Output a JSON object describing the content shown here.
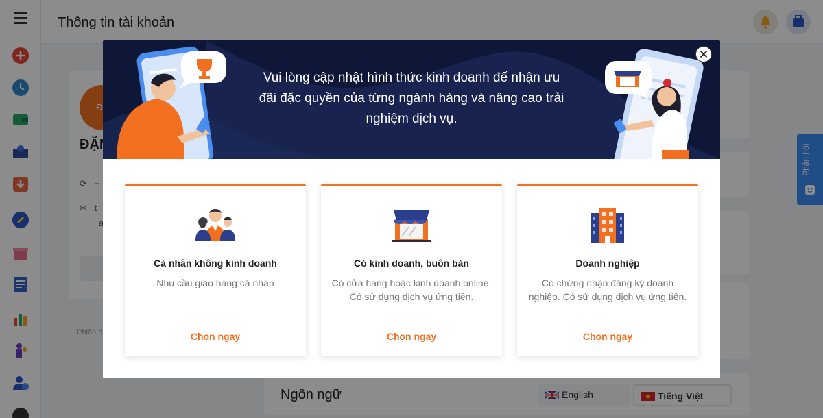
{
  "header": {
    "title": "Thông tin tài khoản"
  },
  "profile": {
    "avatar_text": "ĐE",
    "name": "ĐẶNG NHÂ",
    "phone_partial": "+",
    "email_partial": "t",
    "email_partial_line2": "a",
    "version_partial": "Phiên b"
  },
  "language": {
    "title": "Ngôn ngữ",
    "options": [
      "English",
      "Tiếng Việt"
    ],
    "selected": "Tiếng Việt"
  },
  "feedback_tab": {
    "label": "Phản hồi"
  },
  "modal": {
    "banner_text": "Vui lòng cập nhật hình thức kinh doanh để nhận ưu đãi đặc quyền của từng ngành hàng và nâng cao trải nghiệm dịch vụ.",
    "close_icon": "close-icon",
    "cards": [
      {
        "icon": "people-icon",
        "title": "Cá nhân không kinh doanh",
        "description": "Nhu cầu giao hàng cá nhân",
        "action": "Chọn ngay"
      },
      {
        "icon": "shop-icon",
        "title": "Có kinh doanh, buôn bán",
        "description": "Có cửa hàng hoặc kinh doanh online. Có sử dụng dịch vụ ứng tiền.",
        "action": "Chọn ngay"
      },
      {
        "icon": "building-icon",
        "title": "Doanh nghiệp",
        "description": "Có chứng nhận đăng ký doanh nghiệp. Có sử dụng dịch vụ ứng tiền.",
        "action": "Chọn ngay"
      }
    ]
  },
  "colors": {
    "accent": "#f37021",
    "banner_bg": "#0e1737",
    "feedback": "#3b8cf2"
  }
}
